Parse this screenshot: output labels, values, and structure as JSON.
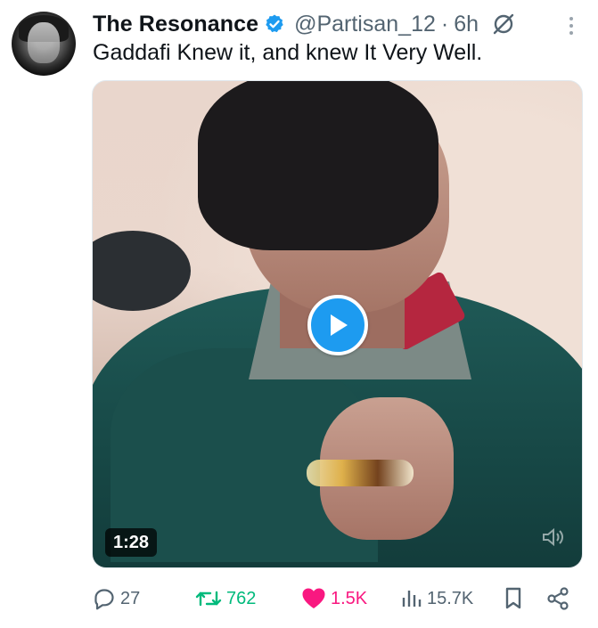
{
  "tweet": {
    "display_name": "The Resonance",
    "handle": "@Partisan_12",
    "separator": "·",
    "time": "6h",
    "text": "Gaddafi Knew it, and knew It Very Well.",
    "video": {
      "duration": "1:28"
    },
    "stats": {
      "replies": "27",
      "retweets": "762",
      "likes": "1.5K",
      "views": "15.7K"
    }
  },
  "colors": {
    "accent_blue": "#1d9bf0",
    "retweet_green": "#00ba7c",
    "like_pink": "#f91880",
    "muted_text": "#536471"
  },
  "icons": {
    "verified": "verified-badge-icon",
    "grok": "grok-icon",
    "more": "more-icon",
    "play": "play-icon",
    "mute": "mute-icon",
    "reply": "reply-icon",
    "retweet": "retweet-icon",
    "like": "heart-icon",
    "views": "views-icon",
    "bookmark": "bookmark-icon",
    "share": "share-icon"
  }
}
